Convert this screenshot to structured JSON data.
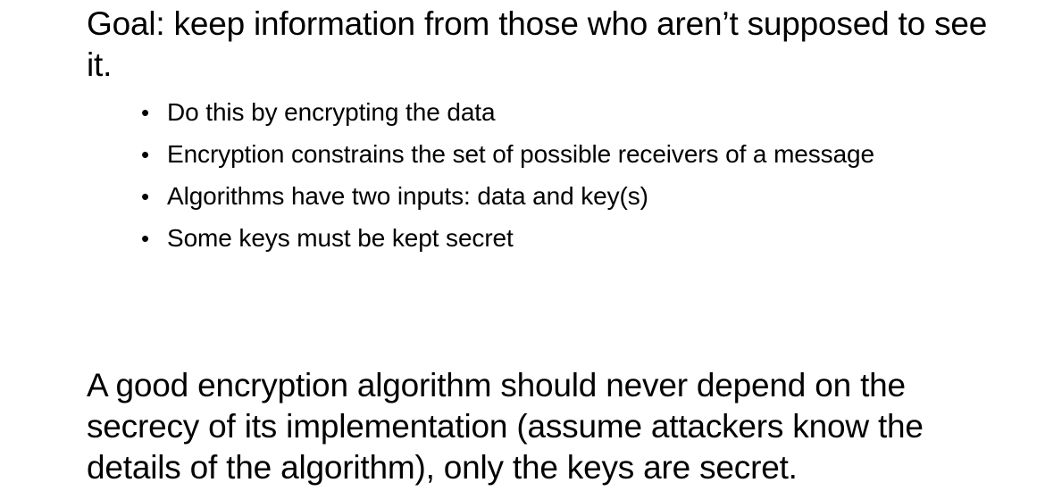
{
  "slide": {
    "goal_text": "Goal: keep information from those who aren’t supposed to see it.",
    "bullets": [
      "Do this by encrypting the data",
      "Encryption constrains the set of possible receivers of a message",
      "Algorithms have two inputs: data and key(s)",
      "Some keys must be kept secret"
    ],
    "bullet_glyph": "•",
    "conclusion_text": "A good encryption algorithm should never depend on the secrecy of its implementation (assume attackers know the details of the algorithm), only the keys are secret."
  }
}
